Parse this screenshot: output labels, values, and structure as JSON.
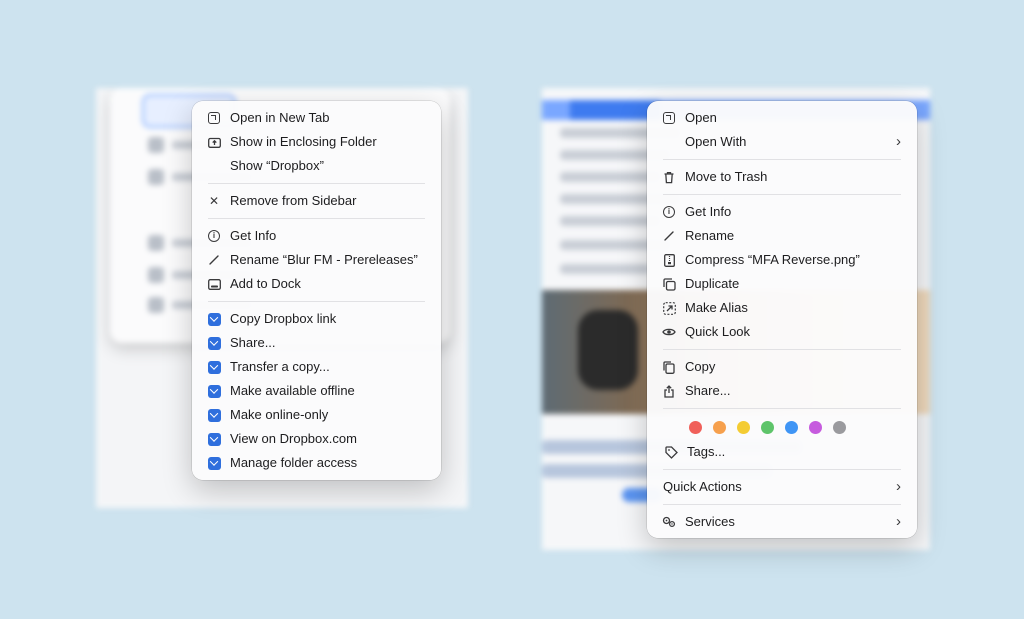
{
  "left_menu": {
    "items": [
      {
        "label": "Open in New Tab",
        "icon": "open-tab-icon"
      },
      {
        "label": "Show in Enclosing Folder",
        "icon": "enclosing-folder-icon"
      },
      {
        "label": "Show “Dropbox”",
        "icon": ""
      },
      {
        "label": "Remove from Sidebar",
        "icon": "close-icon"
      },
      {
        "label": "Get Info",
        "icon": "info-icon"
      },
      {
        "label": "Rename “Blur FM - Prereleases”",
        "icon": "pencil-icon"
      },
      {
        "label": "Add to Dock",
        "icon": "dock-icon"
      },
      {
        "label": "Copy Dropbox link",
        "icon": "dropbox-icon"
      },
      {
        "label": "Share...",
        "icon": "dropbox-icon"
      },
      {
        "label": "Transfer a copy...",
        "icon": "dropbox-icon"
      },
      {
        "label": "Make available offline",
        "icon": "dropbox-icon"
      },
      {
        "label": "Make online-only",
        "icon": "dropbox-icon"
      },
      {
        "label": "View on Dropbox.com",
        "icon": "dropbox-icon"
      },
      {
        "label": "Manage folder access",
        "icon": "dropbox-icon"
      }
    ]
  },
  "right_menu": {
    "items": [
      {
        "label": "Open",
        "icon": "open-icon"
      },
      {
        "label": "Open With",
        "icon": ""
      },
      {
        "label": "Move to Trash",
        "icon": "trash-icon"
      },
      {
        "label": "Get Info",
        "icon": "info-icon"
      },
      {
        "label": "Rename",
        "icon": "pencil-icon"
      },
      {
        "label": "Compress “MFA Reverse.png”",
        "icon": "archive-icon"
      },
      {
        "label": "Duplicate",
        "icon": "duplicate-icon"
      },
      {
        "label": "Make Alias",
        "icon": "alias-icon"
      },
      {
        "label": "Quick Look",
        "icon": "eye-icon"
      },
      {
        "label": "Copy",
        "icon": "copy-icon"
      },
      {
        "label": "Share...",
        "icon": "share-icon"
      },
      {
        "label": "Tags...",
        "icon": "tag-icon"
      },
      {
        "label": "Quick Actions",
        "icon": ""
      },
      {
        "label": "Services",
        "icon": "services-icon"
      }
    ],
    "tag_colors": [
      {
        "name": "red",
        "color": "#f0605a"
      },
      {
        "name": "orange",
        "color": "#f6a04d"
      },
      {
        "name": "yellow",
        "color": "#f4cc33"
      },
      {
        "name": "green",
        "color": "#5ec46a"
      },
      {
        "name": "blue",
        "color": "#3f95f5"
      },
      {
        "name": "purple",
        "color": "#c65bde"
      },
      {
        "name": "gray",
        "color": "#9a9a9e"
      }
    ]
  }
}
